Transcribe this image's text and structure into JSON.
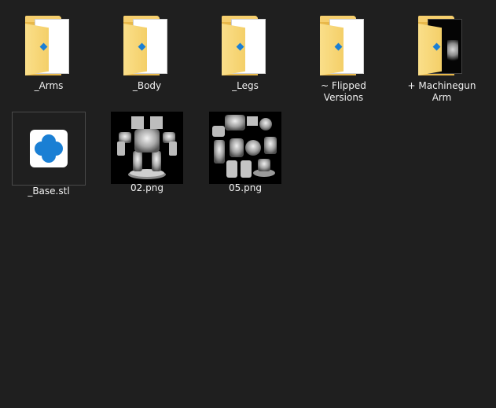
{
  "items": [
    {
      "label": "_Arms",
      "kind": "folder"
    },
    {
      "label": "_Body",
      "kind": "folder"
    },
    {
      "label": "_Legs",
      "kind": "folder"
    },
    {
      "label": "~ Flipped Versions",
      "kind": "folder"
    },
    {
      "label": "+ Machinegun Arm",
      "kind": "folder-preview"
    },
    {
      "label": "_Base.stl",
      "kind": "stl",
      "selected": true
    },
    {
      "label": "02.png",
      "kind": "image"
    },
    {
      "label": "05.png",
      "kind": "image"
    }
  ],
  "colors": {
    "background": "#1f1f1f",
    "folder_yellow": "#f4cf68",
    "stl_blue": "#1a7fd4",
    "label_text": "#f0f0f0"
  },
  "icons": {
    "folder": "folder-icon",
    "stl": "stl-file-icon",
    "image": "image-thumbnail"
  }
}
